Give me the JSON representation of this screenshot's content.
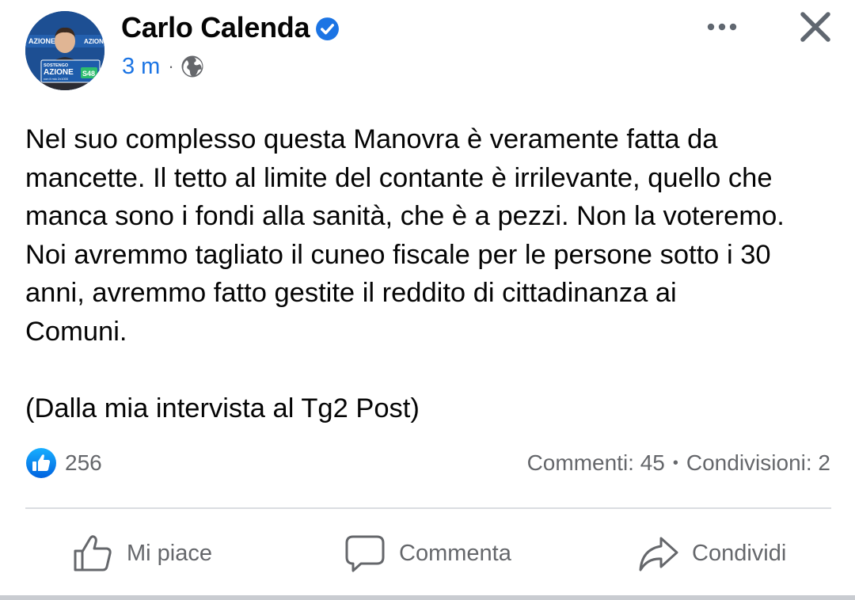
{
  "post": {
    "author": "Carlo Calenda",
    "timestamp": "3 m",
    "meta_separator": "·",
    "avatar_banner": {
      "brand": "AZIONE",
      "top_text": "SOSTENGO",
      "sub_text": "con il mio 2x1000",
      "code": "S48"
    },
    "text": "Nel suo complesso questa Manovra è veramente fatta da\nmancette. Il tetto al limite del contante è irrilevante, quello che\nmanca sono i fondi alla sanità, che è a pezzi. Non la voteremo.\nNoi avremmo tagliato il cuneo fiscale per le persone sotto i 30\nanni, avremmo fatto gestite il reddito di cittadinanza ai\nComuni.\n\n(Dalla mia intervista al Tg2 Post)"
  },
  "stats": {
    "likes": "256",
    "comments": "Commenti: 45",
    "separator": "•",
    "shares": "Condivisioni: 2"
  },
  "actions": {
    "like_label": "Mi piace",
    "comment_label": "Commenta",
    "share_label": "Condividi"
  },
  "icons": {
    "verified": "verified-badge-icon",
    "privacy": "globe-icon",
    "more": "more-horizontal-icon",
    "close": "close-icon",
    "reaction": "like-reaction-icon",
    "like": "thumbs-up-icon",
    "comment": "comment-bubble-icon",
    "share": "share-arrow-icon"
  },
  "colors": {
    "accent": "#1b74e4",
    "text_primary": "#050505",
    "text_secondary": "#65676b",
    "divider": "#dadde1"
  }
}
